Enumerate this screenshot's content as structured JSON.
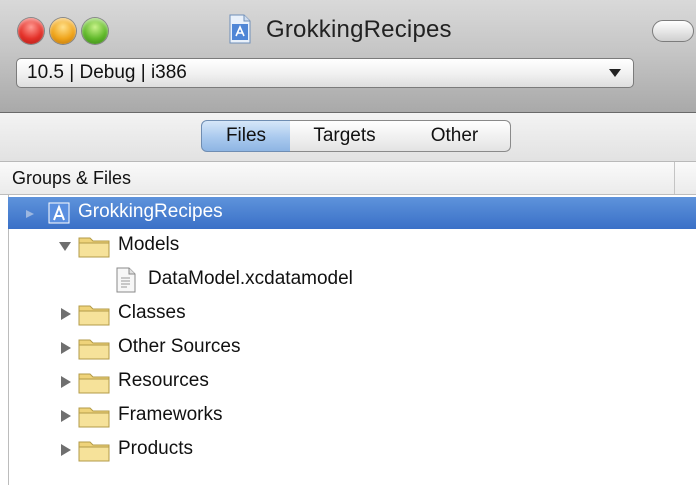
{
  "window": {
    "title": "GrokkingRecipes",
    "title_icon": "xcode-project-icon"
  },
  "config_popup": {
    "selected": "10.5 | Debug | i386"
  },
  "view_tabs": [
    {
      "label": "Files",
      "selected": true
    },
    {
      "label": "Targets",
      "selected": false
    },
    {
      "label": "Other",
      "selected": false
    }
  ],
  "outline": {
    "header": "Groups & Files",
    "items": [
      {
        "label": "GrokkingRecipes",
        "icon": "xcode-project-icon",
        "selected": true,
        "level": 0
      },
      {
        "label": "Models",
        "icon": "folder-icon",
        "expanded": true,
        "level": 1
      },
      {
        "label": "DataModel.xcdatamodel",
        "icon": "file-icon",
        "level": 2
      },
      {
        "label": "Classes",
        "icon": "folder-icon",
        "expanded": false,
        "level": 1
      },
      {
        "label": "Other Sources",
        "icon": "folder-icon",
        "expanded": false,
        "level": 1
      },
      {
        "label": "Resources",
        "icon": "folder-icon",
        "expanded": false,
        "level": 1
      },
      {
        "label": "Frameworks",
        "icon": "folder-icon",
        "expanded": false,
        "level": 1
      },
      {
        "label": "Products",
        "icon": "folder-icon",
        "expanded": false,
        "level": 1
      }
    ]
  },
  "colors": {
    "selection": "#3f75cc",
    "segment_selected": "#a9c9ee",
    "folder": "#f0d77a"
  }
}
